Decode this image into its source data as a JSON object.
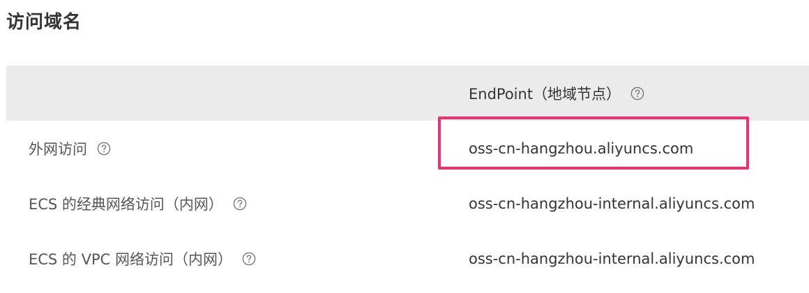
{
  "section": {
    "title": "访问域名"
  },
  "table": {
    "header": {
      "label": "",
      "endpoint": "EndPoint（地域节点）",
      "endpoint_help_icon": "question-circle-icon"
    },
    "rows": [
      {
        "label": "外网访问",
        "help_icon": "question-circle-icon",
        "endpoint": "oss-cn-hangzhou.aliyuncs.com",
        "highlighted": true
      },
      {
        "label": "ECS 的经典网络访问（内网）",
        "help_icon": "question-circle-icon",
        "endpoint": "oss-cn-hangzhou-internal.aliyuncs.com",
        "highlighted": false
      },
      {
        "label": "ECS 的 VPC 网络访问（内网）",
        "help_icon": "question-circle-icon",
        "endpoint": "oss-cn-hangzhou-internal.aliyuncs.com",
        "highlighted": false
      }
    ]
  },
  "colors": {
    "header_bg": "#ebebeb",
    "highlight_border": "#f0306e",
    "text": "#333333",
    "label_text": "#555555",
    "icon": "#777777"
  }
}
